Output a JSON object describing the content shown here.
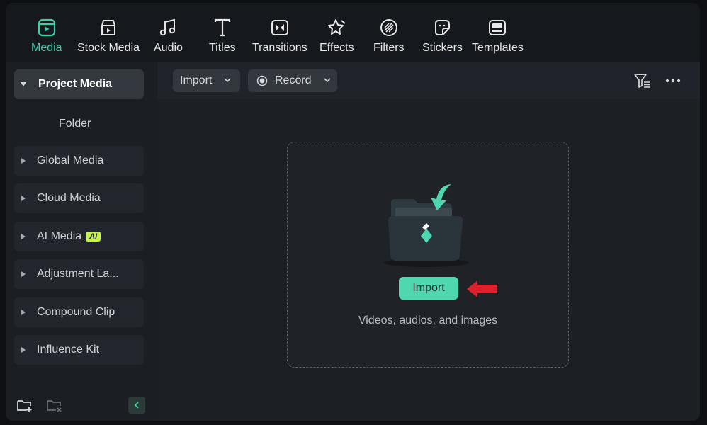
{
  "toolbar": {
    "tabs": [
      {
        "label": "Media",
        "icon": "media-icon",
        "active": true
      },
      {
        "label": "Stock Media",
        "icon": "stock-media-icon"
      },
      {
        "label": "Audio",
        "icon": "music-note-icon"
      },
      {
        "label": "Titles",
        "icon": "titles-t-icon"
      },
      {
        "label": "Transitions",
        "icon": "transitions-icon"
      },
      {
        "label": "Effects",
        "icon": "effects-star-icon"
      },
      {
        "label": "Filters",
        "icon": "filters-icon"
      },
      {
        "label": "Stickers",
        "icon": "stickers-icon"
      },
      {
        "label": "Templates",
        "icon": "templates-icon"
      }
    ]
  },
  "sidebar": {
    "project_media": "Project Media",
    "folder": "Folder",
    "items": [
      {
        "label": "Global Media"
      },
      {
        "label": "Cloud Media"
      },
      {
        "label": "AI Media",
        "badge": "AI"
      },
      {
        "label": "Adjustment La..."
      },
      {
        "label": "Compound Clip"
      },
      {
        "label": "Influence Kit"
      }
    ]
  },
  "main": {
    "import_dropdown": "Import",
    "record_dropdown": "Record",
    "dropzone": {
      "import_button": "Import",
      "hint": "Videos, audios, and images"
    }
  },
  "colors": {
    "accent": "#34d3ac",
    "import_button": "#4fd8b0",
    "ai_badge": "#c8f34f",
    "arrow_annotation": "#e0202a"
  }
}
